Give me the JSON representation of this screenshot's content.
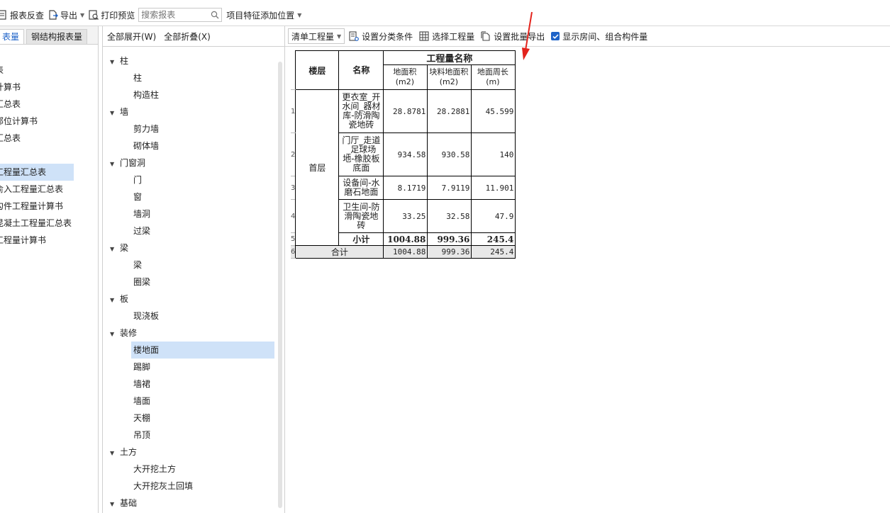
{
  "toolbar": {
    "review_label": "报表反查",
    "export_label": "导出",
    "print_label": "打印预览",
    "search_placeholder": "搜索报表",
    "feature_label": "项目特征添加位置"
  },
  "left": {
    "tabs": [
      "表量",
      "钢结构报表量"
    ],
    "items": [
      {
        "label": "表",
        "selected": false
      },
      {
        "label": "计算书",
        "selected": false
      },
      {
        "label": "汇总表",
        "selected": false
      },
      {
        "label": "部位计算书",
        "selected": false
      },
      {
        "label": "汇总表",
        "selected": false
      },
      {
        "label": "",
        "selected": false
      },
      {
        "label": "工程量汇总表",
        "selected": true
      },
      {
        "label": "俞入工程量汇总表",
        "selected": false
      },
      {
        "label": "勾件工程量计算书",
        "selected": false
      },
      {
        "label": "昆凝土工程量汇总表",
        "selected": false
      },
      {
        "label": "工程量计算书",
        "selected": false
      }
    ]
  },
  "middle": {
    "expand_all": "全部展开(W)",
    "collapse_all": "全部折叠(X)",
    "tree": [
      {
        "label": "柱",
        "children": [
          "柱",
          "构造柱"
        ]
      },
      {
        "label": "墙",
        "children": [
          "剪力墙",
          "砌体墙"
        ]
      },
      {
        "label": "门窗洞",
        "children": [
          "门",
          "窗",
          "墙洞",
          "过梁"
        ]
      },
      {
        "label": "梁",
        "children": [
          "梁",
          "圈梁"
        ]
      },
      {
        "label": "板",
        "children": [
          "现浇板"
        ]
      },
      {
        "label": "装修",
        "children": [
          "楼地面",
          "踢脚",
          "墙裙",
          "墙面",
          "天棚",
          "吊顶"
        ]
      },
      {
        "label": "土方",
        "children": [
          "大开挖土方",
          "大开挖灰土回填"
        ]
      },
      {
        "label": "基础",
        "children": []
      }
    ],
    "selected": "楼地面"
  },
  "right_toolbar": {
    "list_dropdown": "清单工程量",
    "set_category": "设置分类条件",
    "select_quantity": "选择工程量",
    "batch_export": "设置批量导出",
    "show_rooms": "显示房间、组合构件量",
    "show_rooms_checked": true
  },
  "report": {
    "header": {
      "floor": "楼层",
      "name": "名称",
      "group": "工程量名称",
      "cols": [
        "地面积(m2)",
        "块料地面积(m2)",
        "地面周长(m)"
      ]
    },
    "floor_label": "首层",
    "rows": [
      {
        "no": "1",
        "name": "更衣室_开水间_器材库-防滑陶瓷地砖",
        "values": [
          "28.8781",
          "28.2881",
          "45.599"
        ]
      },
      {
        "no": "2",
        "name": "门厅_走道_足球场地-橡胶板底面",
        "values": [
          "934.58",
          "930.58",
          "140"
        ]
      },
      {
        "no": "3",
        "name": "设备间-水磨石地面",
        "values": [
          "8.1719",
          "7.9119",
          "11.901"
        ]
      },
      {
        "no": "4",
        "name": "卫生间-防滑陶瓷地砖",
        "values": [
          "33.25",
          "32.58",
          "47.9"
        ]
      }
    ],
    "subtotal": {
      "no": "5",
      "label": "小计",
      "values": [
        "1004.88",
        "999.36",
        "245.4"
      ]
    },
    "total": {
      "no": "6",
      "label": "合计",
      "values": [
        "1004.88",
        "999.36",
        "245.4"
      ]
    }
  },
  "colors": {
    "accent": "#1e63c8",
    "selection": "#cfe2f8",
    "arrow": "#e3231c"
  }
}
